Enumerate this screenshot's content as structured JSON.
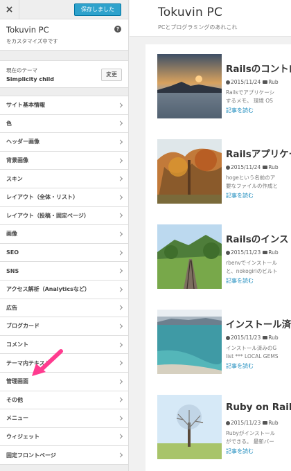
{
  "customizer": {
    "close_label": "×",
    "save_label": "保存しました",
    "site_title": "Tokuvin PC",
    "site_subtitle": "をカスタマイズ中です",
    "help_label": "?",
    "theme_label": "現在のテーマ",
    "theme_name": "Simplicity child",
    "change_label": "変更",
    "sections": [
      "サイト基本情報",
      "色",
      "ヘッダー画像",
      "背景画像",
      "スキン",
      "レイアウト（全体・リスト）",
      "レイアウト（投稿・固定ページ）",
      "画像",
      "SEO",
      "SNS",
      "アクセス解析（Analyticsなど）",
      "広告",
      "ブログカード",
      "コメント",
      "テーマ内テキスト",
      "管理画面",
      "その他",
      "メニュー",
      "ウィジェット",
      "固定フロントページ"
    ],
    "arrow_color": "#ff3b8f"
  },
  "preview": {
    "title": "Tokuvin PC",
    "description": "PCとプログラミングのあれこれ",
    "read_more": "記事を読む",
    "articles": [
      {
        "title": "Railsのコントロ",
        "date": "2015/11/24",
        "category": "Rub",
        "excerpt": [
          "Railsでアプリケーシ",
          "するメモ。 環境 OS "
        ]
      },
      {
        "title": "Railsアプリケー",
        "date": "2015/11/24",
        "category": "Rub",
        "excerpt": [
          "hogeという名前のア",
          "要なファイルの作成と"
        ]
      },
      {
        "title": "Railsのインスト",
        "date": "2015/11/23",
        "category": "Rub",
        "excerpt": [
          "rbenvでインストール",
          "と、nokogiriのビルト"
        ]
      },
      {
        "title": "インストール済",
        "date": "2015/11/23",
        "category": "Rub",
        "excerpt": [
          "インストール済みのG",
          "list *** LOCAL GEMS"
        ]
      },
      {
        "title": "Ruby on Rails",
        "date": "2015/11/23",
        "category": "Rub",
        "excerpt": [
          "Rubyがインストール",
          "ができる。 最新バー"
        ]
      }
    ]
  },
  "colors": {
    "accent": "#2ea2cc",
    "link": "#1e8cbe"
  }
}
